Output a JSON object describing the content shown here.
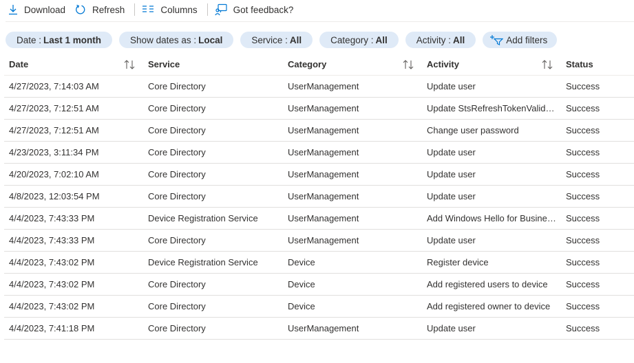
{
  "toolbar": {
    "download": "Download",
    "refresh": "Refresh",
    "columns": "Columns",
    "feedback": "Got feedback?"
  },
  "filters": [
    {
      "label": "Date :",
      "value": "Last 1 month"
    },
    {
      "label": "Show dates as :",
      "value": "Local"
    },
    {
      "label": "Service :",
      "value": "All"
    },
    {
      "label": "Category :",
      "value": "All"
    },
    {
      "label": "Activity :",
      "value": "All"
    }
  ],
  "add_filters": "Add filters",
  "columns": {
    "date": "Date",
    "service": "Service",
    "category": "Category",
    "activity": "Activity",
    "status": "Status"
  },
  "rows": [
    {
      "date": "4/27/2023, 7:14:03 AM",
      "service": "Core Directory",
      "category": "UserManagement",
      "activity": "Update user",
      "status": "Success"
    },
    {
      "date": "4/27/2023, 7:12:51 AM",
      "service": "Core Directory",
      "category": "UserManagement",
      "activity": "Update StsRefreshTokenValidFr...",
      "status": "Success"
    },
    {
      "date": "4/27/2023, 7:12:51 AM",
      "service": "Core Directory",
      "category": "UserManagement",
      "activity": "Change user password",
      "status": "Success"
    },
    {
      "date": "4/23/2023, 3:11:34 PM",
      "service": "Core Directory",
      "category": "UserManagement",
      "activity": "Update user",
      "status": "Success"
    },
    {
      "date": "4/20/2023, 7:02:10 AM",
      "service": "Core Directory",
      "category": "UserManagement",
      "activity": "Update user",
      "status": "Success"
    },
    {
      "date": "4/8/2023, 12:03:54 PM",
      "service": "Core Directory",
      "category": "UserManagement",
      "activity": "Update user",
      "status": "Success"
    },
    {
      "date": "4/4/2023, 7:43:33 PM",
      "service": "Device Registration Service",
      "category": "UserManagement",
      "activity": "Add Windows Hello for Busines...",
      "status": "Success"
    },
    {
      "date": "4/4/2023, 7:43:33 PM",
      "service": "Core Directory",
      "category": "UserManagement",
      "activity": "Update user",
      "status": "Success"
    },
    {
      "date": "4/4/2023, 7:43:02 PM",
      "service": "Device Registration Service",
      "category": "Device",
      "activity": "Register device",
      "status": "Success"
    },
    {
      "date": "4/4/2023, 7:43:02 PM",
      "service": "Core Directory",
      "category": "Device",
      "activity": "Add registered users to device",
      "status": "Success"
    },
    {
      "date": "4/4/2023, 7:43:02 PM",
      "service": "Core Directory",
      "category": "Device",
      "activity": "Add registered owner to device",
      "status": "Success"
    },
    {
      "date": "4/4/2023, 7:41:18 PM",
      "service": "Core Directory",
      "category": "UserManagement",
      "activity": "Update user",
      "status": "Success"
    }
  ],
  "icons": {
    "download": "download-icon",
    "refresh": "refresh-icon",
    "columns": "columns-icon",
    "feedback": "feedback-icon",
    "add_filter": "add-filter-icon",
    "sort": "sort-icon"
  },
  "colors": {
    "accent": "#0078d4",
    "pill_bg": "#dfeaf7",
    "text": "#323130"
  }
}
